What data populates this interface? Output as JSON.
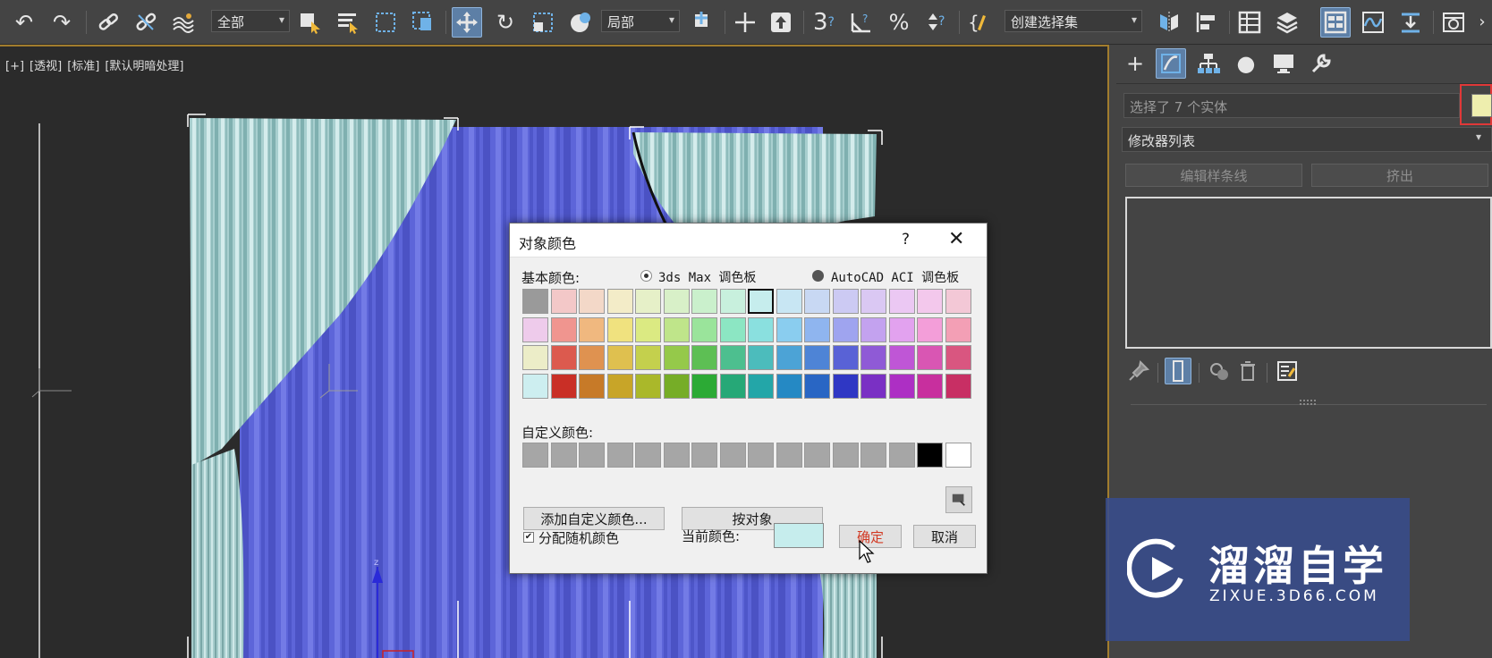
{
  "toolbar": {
    "selection_filter": "全部",
    "coordinate_system": "局部",
    "named_selection_set": "创建选择集"
  },
  "viewport": {
    "label_plus": "[+]",
    "label_view": "[透视]",
    "label_standard": "[标准]",
    "label_shading": "[默认明暗处理]"
  },
  "command_panel": {
    "selection_info": "选择了 7 个实体",
    "modifier_list": "修改器列表",
    "btn_edit_spline": "编辑样条线",
    "btn_extrude": "挤出"
  },
  "dialog": {
    "title": "对象颜色",
    "help": "?",
    "basic_colors_label": "基本颜色:",
    "radio_max": "3ds Max 调色板",
    "radio_aci": "AutoCAD ACI 调色板",
    "custom_colors_label": "自定义颜色:",
    "btn_add_custom": "添加自定义颜色...",
    "btn_by_object": "按对象",
    "checkbox_random": "分配随机颜色",
    "current_color_label": "当前颜色:",
    "current_color": "#c6eded",
    "btn_ok": "确定",
    "btn_cancel": "取消",
    "palette": [
      [
        "#9a9a9a",
        "#f3c8c8",
        "#f3d8c8",
        "#f3ecc8",
        "#e6f0c8",
        "#d8f0c8",
        "#caf0cc",
        "#c8f0dd",
        "#c6eded",
        "#c8e6f3",
        "#c8d8f3",
        "#cccaf3",
        "#dac8f3",
        "#ebc8f3",
        "#f3c8ec",
        "#f3c8d6"
      ],
      [
        "#eecbeb",
        "#f0958f",
        "#f0b87f",
        "#f0e27f",
        "#dbea82",
        "#bfe58a",
        "#9ae49b",
        "#8ce6c3",
        "#8ae0df",
        "#8acdef",
        "#8fb5ef",
        "#9fa4ef",
        "#c3a2ef",
        "#e2a2ef",
        "#f39ed9",
        "#f39fb5"
      ],
      [
        "#ecedc8",
        "#dc5a4e",
        "#df9250",
        "#dfc04f",
        "#c4d04d",
        "#95c94a",
        "#5dbf54",
        "#4dbf8f",
        "#4cbcbc",
        "#4ca3d6",
        "#4e84d6",
        "#5962d6",
        "#8f5ad6",
        "#bf56d6",
        "#d956b3",
        "#d95680"
      ],
      [
        "#cdeef0",
        "#c92f26",
        "#c77a28",
        "#c8a528",
        "#aab82a",
        "#76ad27",
        "#2caa35",
        "#26a877",
        "#23a6a8",
        "#2589c4",
        "#2966c4",
        "#2f37c4",
        "#7a30c4",
        "#ad2fc4",
        "#c82f9e",
        "#c82f64"
      ]
    ],
    "custom_palette": [
      "#a6a6a6",
      "#a6a6a6",
      "#a6a6a6",
      "#a6a6a6",
      "#a6a6a6",
      "#a6a6a6",
      "#a6a6a6",
      "#a6a6a6",
      "#a6a6a6",
      "#a6a6a6",
      "#a6a6a6",
      "#a6a6a6",
      "#a6a6a6",
      "#a6a6a6",
      "#000000",
      "#ffffff"
    ]
  },
  "watermark": {
    "brand": "溜溜自学",
    "site": "ZIXUE.3D66.COM"
  }
}
